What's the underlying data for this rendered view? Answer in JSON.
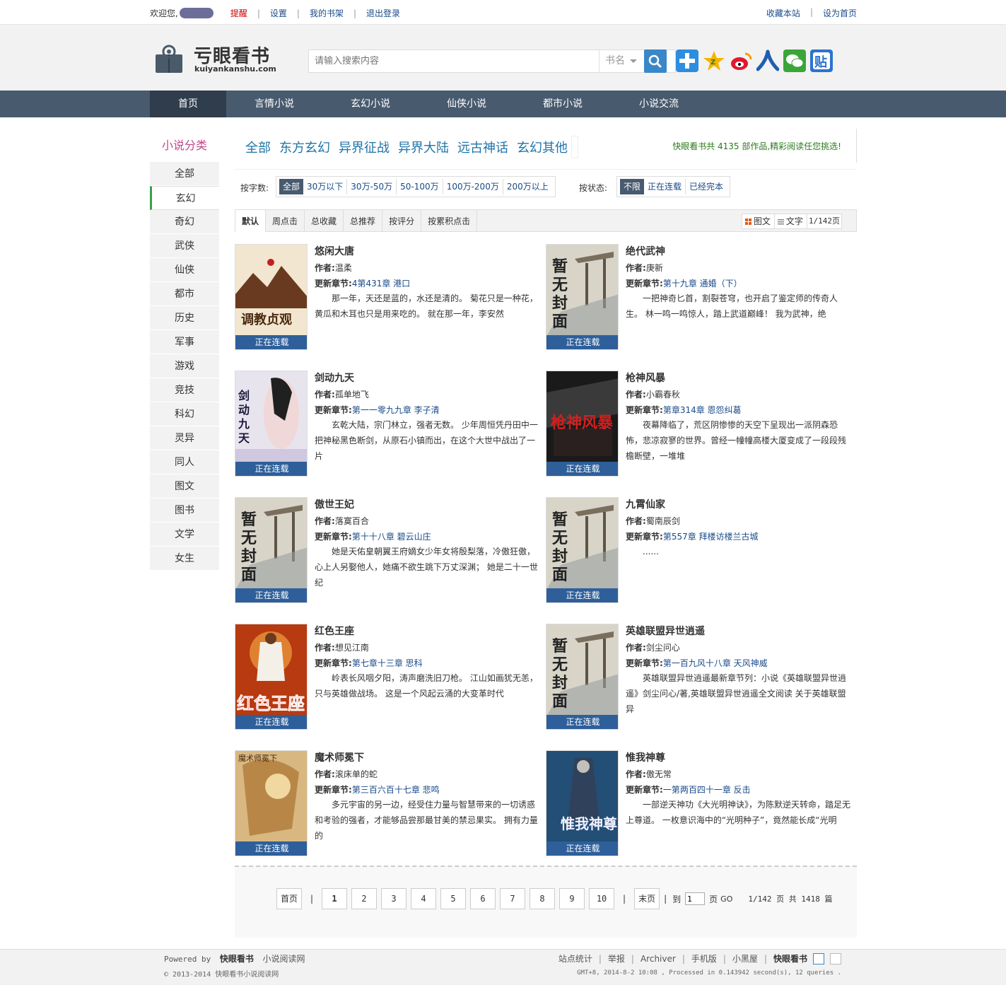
{
  "topbar": {
    "welcome": "欢迎您,",
    "links": [
      "提醒",
      "设置",
      "我的书架",
      "退出登录"
    ],
    "right_links": [
      "收藏本站",
      "设为首页"
    ]
  },
  "logo": {
    "zh": "亏眼看书",
    "en": "kuiyankanshu.com"
  },
  "search": {
    "placeholder": "请输入搜索内容",
    "select": "书名"
  },
  "nav": [
    "首页",
    "言情小说",
    "玄幻小说",
    "仙侠小说",
    "都市小说",
    "小说交流"
  ],
  "sidebar": {
    "title": "小说分类",
    "items": [
      "全部",
      "玄幻",
      "奇幻",
      "武侠",
      "仙侠",
      "都市",
      "历史",
      "军事",
      "游戏",
      "竞技",
      "科幻",
      "灵异",
      "同人",
      "图文",
      "图书",
      "文学",
      "女生"
    ],
    "active": 1
  },
  "subcats": {
    "items": [
      "全部",
      "东方玄幻",
      "异界征战",
      "异界大陆",
      "远古神话",
      "玄幻其他"
    ],
    "count_text": "快眼看书共 4135 部作品,精彩阅读任您挑选!"
  },
  "filters": {
    "words_label": "按字数:",
    "words": [
      "全部",
      "30万以下",
      "30万-50万",
      "50-100万",
      "100万-200万",
      "200万以上"
    ],
    "status_label": "按状态:",
    "status": [
      "不限",
      "正在连载",
      "已经完本"
    ]
  },
  "sort": {
    "tabs": [
      "默认",
      "周点击",
      "总收藏",
      "总推荐",
      "按评分",
      "按累积点击"
    ],
    "views": [
      "图文",
      "文字"
    ],
    "page": "1/142页"
  },
  "labels": {
    "author": "作者:",
    "latest": "更新章节:",
    "status_badge": "正在连载"
  },
  "books": [
    {
      "title": "悠闲大唐",
      "author": "温柔",
      "chapter": "4第431章 港口",
      "intro": "那一年，天还是蓝的，水还是清的。 菊花只是一种花，黄瓜和木耳也只是用来吃的。 就在那一年，李安然",
      "cover": "tang"
    },
    {
      "title": "绝代武神",
      "author": "庚新",
      "chapter": "第十九章 通婚（下）",
      "intro": "一把神奇匕首，割裂苍穹，也开启了鉴定师的传奇人生。 林一鸣一鸣惊人，踏上武道巅峰！ 我为武神，绝",
      "cover": "none"
    },
    {
      "title": "剑动九天",
      "author": "孤单地飞",
      "chapter": "第一一零九九章 李子清",
      "intro": "玄乾大陆，宗门林立，强者无数。 少年周恒凭丹田中一把神秘黑色断剑，从原石小镇而出，在这个大世中战出了一片",
      "cover": "jian"
    },
    {
      "title": "枪神风暴",
      "author": "小霸春秋",
      "chapter": "第章314章 恩怨纠葛",
      "intro": "夜幕降临了，荒区阴惨惨的天空下呈现出一派阴森恐怖，悲凉寂寥的世界。曾经一幢幢高楼大厦变成了一段段残檐断壁，一堆堆",
      "cover": "qiang"
    },
    {
      "title": "傲世王妃",
      "author": "落寞百合",
      "chapter": "第十十八章 碧云山庄",
      "intro": "她是天佑皇朝翼王府嫡女少年女将殷梨落，冷傲狂傲，心上人另娶他人，她痛不欲生跳下万丈深渊； 她是二十一世纪",
      "cover": "none"
    },
    {
      "title": "九霄仙家",
      "author": "蜀南辰剑",
      "chapter": "第557章 拜楼访楼兰古城",
      "intro": "......",
      "cover": "none"
    },
    {
      "title": "红色王座",
      "author": "想见江南",
      "chapter": "第七章十三章 思科",
      "intro": "岭表长风咽夕阳，涛声磨洗旧刀枪。 江山如画犹无恙，只与英雄做战场。 这是一个风起云涌的大变革时代",
      "cover": "hong"
    },
    {
      "title": "英雄联盟异世逍遥",
      "author": "剑尘问心",
      "chapter": "第一百九风十八章 天风神威",
      "intro": "英雄联盟异世逍遥最新章节列：小说《英雄联盟异世逍遥》剑尘问心/著,英雄联盟异世逍遥全文阅读 关于英雄联盟异",
      "cover": "none"
    },
    {
      "title": "魔术师冕下",
      "author": "滚床单的蛇",
      "chapter": "第三百六百十七章 悲鸣",
      "intro": "多元宇宙的另一边，经受住力量与智慧带来的一切诱惑和考验的强者，才能够品尝那最甘美的禁忌果实。 拥有力量的",
      "cover": "mo"
    },
    {
      "title": "惟我神尊",
      "author": "傲无常",
      "chapter": "一第两百四十一章 反击",
      "intro": "一部逆天神功《大光明神诀》，为陈默逆天转命，踏足无上尊道。 一枚意识海中的“光明种子”，竟然能长成“光明",
      "cover": "wei"
    }
  ],
  "pager": {
    "first": "首页",
    "pages": [
      "1",
      "2",
      "3",
      "4",
      "5",
      "6",
      "7",
      "8",
      "9",
      "10"
    ],
    "last": "末页",
    "goto_pre": "到",
    "goto_val": "1",
    "goto_post": "页",
    "go": "GO",
    "info": "1/142 页 共 1418 篇"
  },
  "footer": {
    "powered": "Powered by",
    "brand": "快眼看书",
    "sub": "小说阅读网",
    "copy": "© 2013-2014  快眼看书小说阅读网",
    "links": [
      "站点统计",
      "举报",
      "Archiver",
      "手机版",
      "小黑屋"
    ],
    "brand2": "快眼看书",
    "process": "GMT+8, 2014-8-2 10:08 , Processed in 0.143942 second(s), 12 queries ."
  }
}
